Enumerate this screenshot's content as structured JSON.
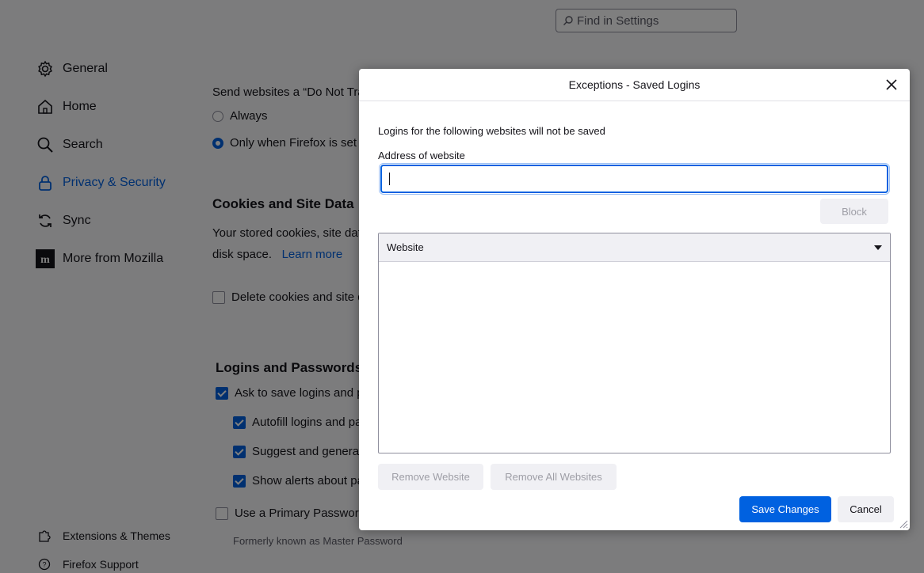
{
  "search": {
    "placeholder": "Find in Settings"
  },
  "sidebar": {
    "items": [
      {
        "label": "General",
        "icon": "gear-icon"
      },
      {
        "label": "Home",
        "icon": "home-icon"
      },
      {
        "label": "Search",
        "icon": "search-icon"
      },
      {
        "label": "Privacy & Security",
        "icon": "lock-icon",
        "active": true
      },
      {
        "label": "Sync",
        "icon": "sync-icon"
      },
      {
        "label": "More from Mozilla",
        "icon": "mozilla-icon"
      }
    ],
    "footer": [
      {
        "label": "Extensions & Themes",
        "icon": "puzzle-icon"
      },
      {
        "label": "Firefox Support",
        "icon": "help-icon"
      }
    ]
  },
  "content": {
    "dnt_text": "Send websites a “Do Not Tra",
    "radio_always": "Always",
    "radio_only": "Only when Firefox is set t",
    "cookies_heading": "Cookies and Site Data",
    "cookies_text1": "Your stored cookies, site dat",
    "cookies_text2": "disk space.",
    "learn_more": "Learn more",
    "delete_cookies": "Delete cookies and site d",
    "logins_heading": "Logins and Passwords",
    "ask_save": "Ask to save logins and p",
    "autofill": "Autofill logins and pa",
    "suggest": "Suggest and generat",
    "alerts": "Show alerts about pa",
    "primary_password": "Use a Primary Password",
    "formerly": "Formerly known as Master Password"
  },
  "dialog": {
    "title": "Exceptions - Saved Logins",
    "description": "Logins for the following websites will not be saved",
    "address_label": "Address of website",
    "address_value": "",
    "block": "Block",
    "column_website": "Website",
    "remove_website": "Remove Website",
    "remove_all": "Remove All Websites",
    "save_changes": "Save Changes",
    "cancel": "Cancel"
  },
  "colors": {
    "accent": "#0061e0",
    "overlay": "rgba(0,0,0,0.5)"
  }
}
